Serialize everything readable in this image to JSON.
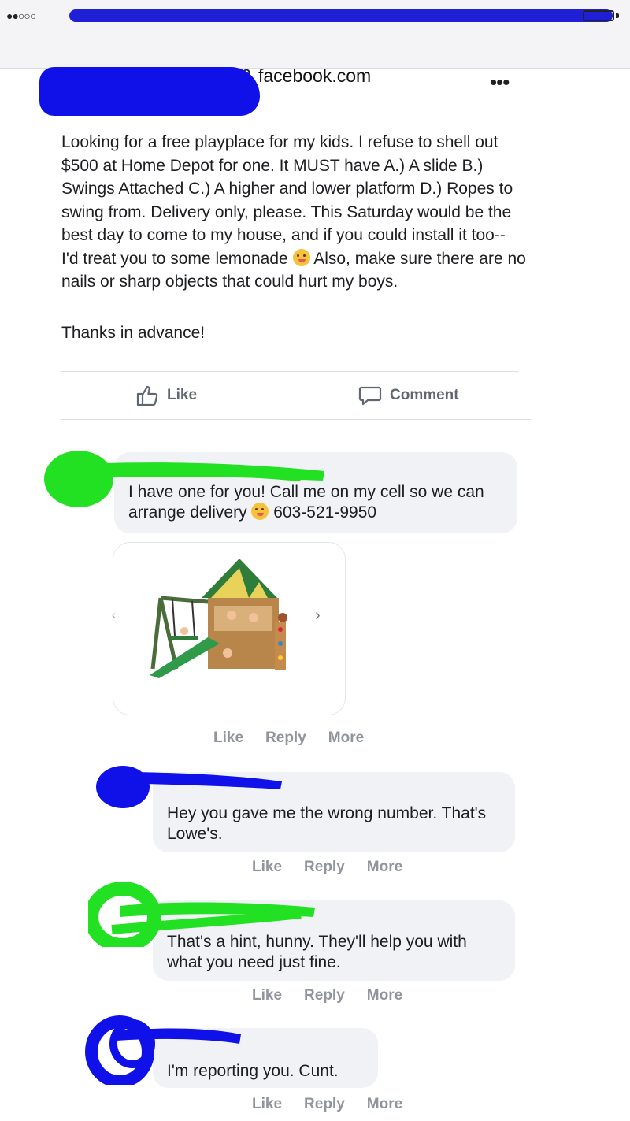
{
  "browser": {
    "signal": "●●○○○",
    "url": "facebook.com"
  },
  "post": {
    "body": "Looking for a free playplace for my kids. I refuse to shell out $500 at Home Depot for one. It MUST have A.) A slide B.) Swings Attached C.) A higher and lower platform D.) Ropes to swing from. Delivery only, please. This Saturday would be the best day to come to my house, and if you could install it too-- I'd treat you to some lemonade",
    "body_after_emoji": " Also, make sure there are no nails or sharp objects that could hurt my boys.",
    "thanks": "Thanks in advance!",
    "more_icon": "•••",
    "actions": {
      "like": "Like",
      "comment": "Comment"
    }
  },
  "comments": [
    {
      "text_before_emoji": "I have one for you! Call me on my cell so we can arrange delivery",
      "text_after_emoji": " 603-521-9950",
      "has_attachment": true,
      "meta": {
        "like": "Like",
        "reply": "Reply",
        "more": "More"
      }
    },
    {
      "text": "Hey you gave me the wrong number. That's Lowe's.",
      "meta": {
        "like": "Like",
        "reply": "Reply",
        "more": "More"
      }
    },
    {
      "text": "That's a hint, hunny. They'll help you with what you need just fine.",
      "meta": {
        "like": "Like",
        "reply": "Reply",
        "more": "More"
      }
    },
    {
      "text": "I'm reporting you. Cunt.",
      "meta": {
        "like": "Like",
        "reply": "Reply",
        "more": "More"
      }
    }
  ],
  "attachment": {
    "next_icon": "›",
    "prev_icon": "‹"
  },
  "colors": {
    "redact_blue": "#1010e8",
    "redact_green": "#22e022",
    "bubble_bg": "#f0f2f5",
    "meta_text": "#90949c"
  }
}
